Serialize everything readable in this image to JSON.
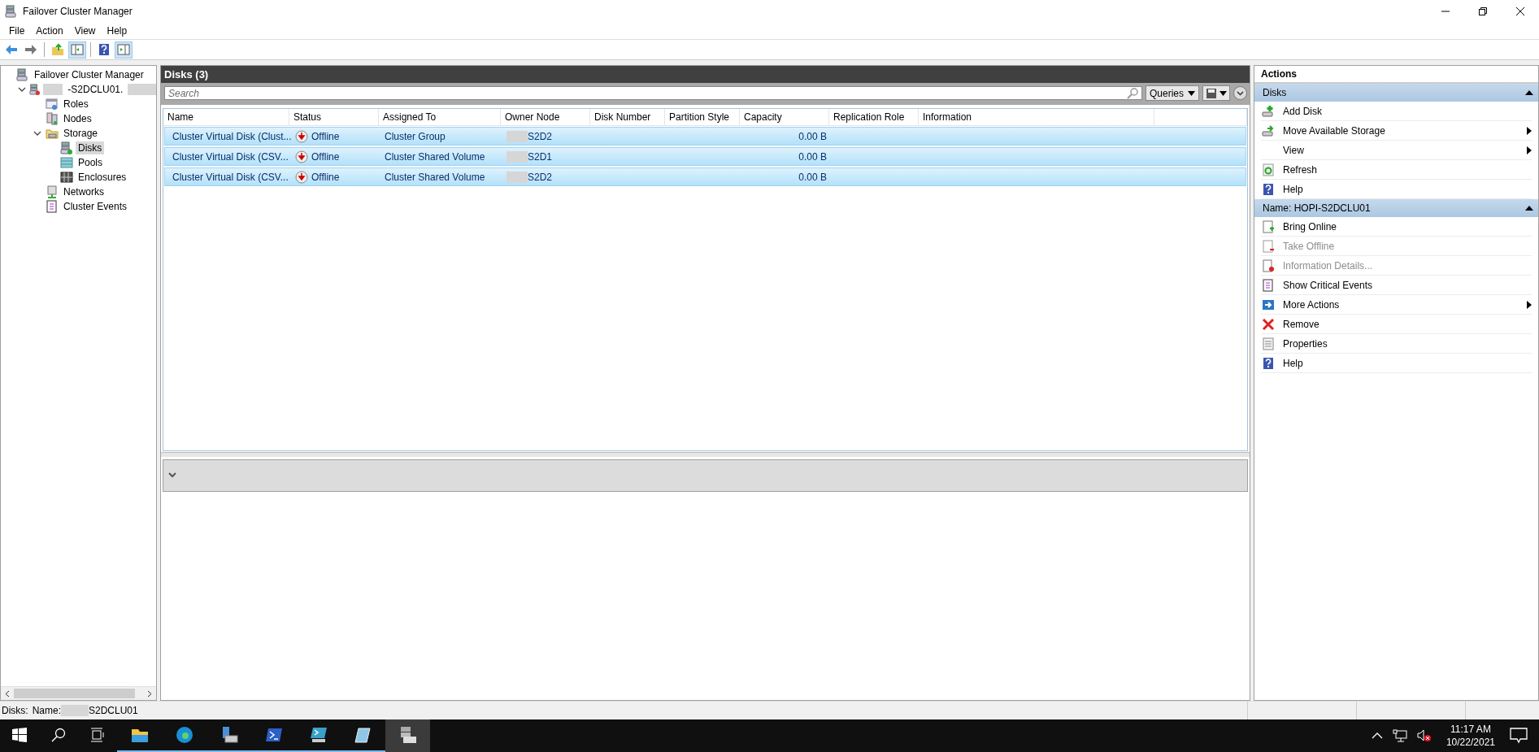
{
  "window": {
    "title": "Failover Cluster Manager"
  },
  "menu": [
    "File",
    "Action",
    "View",
    "Help"
  ],
  "toolbar": [
    {
      "kind": "back",
      "pressed": false
    },
    {
      "kind": "forward",
      "pressed": false
    },
    {
      "kind": "up",
      "pressed": false
    },
    {
      "kind": "tree",
      "pressed": true
    },
    {
      "kind": "help",
      "pressed": false
    },
    {
      "kind": "pane",
      "pressed": true
    }
  ],
  "tree": [
    {
      "label": "Failover Cluster Manager",
      "kind": "manager",
      "selected": false,
      "children": [
        {
          "label": "-S2DCLU01.",
          "kind": "cluster",
          "redacted_before": true,
          "redacted_after": true,
          "expanded": true,
          "selected": false,
          "children": [
            {
              "label": "Roles",
              "kind": "roles",
              "selected": false
            },
            {
              "label": "Nodes",
              "kind": "nodes",
              "selected": false
            },
            {
              "label": "Storage",
              "kind": "folder",
              "expanded": true,
              "selected": false,
              "children": [
                {
                  "label": "Disks",
                  "kind": "disk",
                  "selected": true
                },
                {
                  "label": "Pools",
                  "kind": "pool",
                  "selected": false
                },
                {
                  "label": "Enclosures",
                  "kind": "enclosure",
                  "selected": false
                }
              ]
            },
            {
              "label": "Networks",
              "kind": "network",
              "selected": false
            },
            {
              "label": "Cluster Events",
              "kind": "events",
              "selected": false
            }
          ]
        }
      ]
    }
  ],
  "center": {
    "title": "Disks (3)",
    "search": {
      "placeholder": "Search"
    },
    "queries": "Queries",
    "columns": [
      "Name",
      "Status",
      "Assigned To",
      "Owner Node",
      "Disk Number",
      "Partition Style",
      "Capacity",
      "Replication Role",
      "Information"
    ],
    "rows": [
      {
        "name": "Cluster Virtual Disk (Clust...",
        "status": "Offline",
        "assigned": "Cluster Group",
        "owner": "S2D2",
        "owner_redacted": true,
        "capacity": "0.00 B",
        "selected": true
      },
      {
        "name": "Cluster Virtual Disk (CSV...",
        "status": "Offline",
        "assigned": "Cluster Shared Volume",
        "owner": "S2D1",
        "owner_redacted": true,
        "capacity": "0.00 B",
        "selected": true
      },
      {
        "name": "Cluster Virtual Disk (CSV...",
        "status": "Offline",
        "assigned": "Cluster Shared Volume",
        "owner": "S2D2",
        "owner_redacted": true,
        "capacity": "0.00 B",
        "selected": true
      }
    ]
  },
  "actions": {
    "title": "Actions",
    "sections": [
      {
        "title": "Disks",
        "items": [
          {
            "label": "Add Disk",
            "kind": "add-disk",
            "disabled": false,
            "submenu": false
          },
          {
            "label": "Move Available Storage",
            "kind": "move-disk",
            "disabled": false,
            "submenu": true
          },
          {
            "label": "View",
            "kind": "plain",
            "disabled": false,
            "submenu": true
          },
          {
            "label": "Refresh",
            "kind": "refresh",
            "disabled": false,
            "submenu": false
          },
          {
            "label": "Help",
            "kind": "help",
            "disabled": false,
            "submenu": false
          }
        ]
      },
      {
        "title": "Name: HOPI-S2DCLU01",
        "items": [
          {
            "label": "Bring Online",
            "kind": "online",
            "disabled": false,
            "submenu": false
          },
          {
            "label": "Take Offline",
            "kind": "offline",
            "disabled": true,
            "submenu": false
          },
          {
            "label": "Information Details...",
            "kind": "info",
            "disabled": true,
            "submenu": false
          },
          {
            "label": "Show Critical Events",
            "kind": "events",
            "disabled": false,
            "submenu": false
          },
          {
            "label": "More Actions",
            "kind": "more",
            "disabled": false,
            "submenu": true
          },
          {
            "label": "Remove",
            "kind": "remove",
            "disabled": false,
            "submenu": false
          },
          {
            "label": "Properties",
            "kind": "properties",
            "disabled": false,
            "submenu": false
          },
          {
            "label": "Help",
            "kind": "help",
            "disabled": false,
            "submenu": false
          }
        ]
      }
    ]
  },
  "status_bar": {
    "context": "Disks:",
    "name_label": "Name:",
    "name_redacted": true,
    "name": "S2DCLU01"
  },
  "taskbar": {
    "apps": [
      {
        "kind": "explorer",
        "running": true,
        "active": false
      },
      {
        "kind": "edge",
        "running": true,
        "active": false
      },
      {
        "kind": "server-manager",
        "running": true,
        "active": false
      },
      {
        "kind": "powershell",
        "running": true,
        "active": false
      },
      {
        "kind": "powershell-ise",
        "running": true,
        "active": false
      },
      {
        "kind": "notepad",
        "running": true,
        "active": false
      },
      {
        "kind": "cluster-manager",
        "running": false,
        "active": true
      }
    ],
    "time": "11:17 AM",
    "date": "10/22/2021"
  }
}
